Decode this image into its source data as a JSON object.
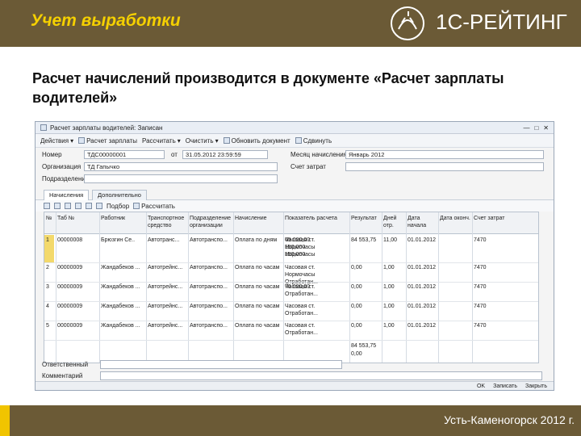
{
  "slide": {
    "title": "Учет выработки",
    "brand": "1С-РЕЙТИНГ",
    "lead": "Расчет начислений производится в документе «Расчет зарплаты водителей»",
    "footer": "Усть-Каменогорск  2012 г."
  },
  "window": {
    "title": "Расчет зарплаты водителей: Записан",
    "toolbar": [
      "Действия",
      "Расчет зарплаты",
      "Рассчитать",
      "Очистить",
      "Обновить документ",
      "Сдвинуть"
    ],
    "fields": {
      "number_label": "Номер",
      "number_value": "ТДС00000001",
      "date_label": "от",
      "date_value": "31.05.2012 23:59:59",
      "period_label": "Месяц начисления",
      "period_value": "Январь 2012",
      "org_label": "Организация",
      "org_value": "ТД Гапычко",
      "account_label": "Счет затрат",
      "account_value": "",
      "dept_label": "Подразделение",
      "dept_value": ""
    },
    "tabs": [
      "Начисления",
      "Дополнительно"
    ],
    "table_toolbar": [
      "Подбор",
      "Рассчитать"
    ],
    "columns": [
      "№",
      "Таб №",
      "Работник",
      "Транспортное средство",
      "Подразделение организации",
      "Начисление",
      "Показатель расчета",
      "Результат",
      "Дней отр.",
      "Дата начала",
      "Дата оконч.",
      "Счет затрат"
    ],
    "rows": [
      {
        "n": "1",
        "tab": "00000008",
        "worker": "Брюзгин Се..",
        "transport": "Автотранс...",
        "dept": "Автотранспо...",
        "accrual": "Оплата по дням",
        "indicators": [
          "Часовая ст.",
          "Нормочасы",
          "Нормочасы"
        ],
        "values": [
          "65 000,00",
          "150,000",
          "150,000"
        ],
        "result": "84 553,75",
        "days": "11,00",
        "start": "01.01.2012",
        "end": "",
        "account": "7470"
      },
      {
        "n": "2",
        "tab": "00000009",
        "worker": "Жандабеков ...",
        "transport": "Автотрейнс...",
        "dept": "Автотранспо...",
        "accrual": "Оплата по часам",
        "indicators": [
          "Часовая ст.",
          "Нормочасы",
          "Отработан..."
        ],
        "values": [
          "",
          "",
          ""
        ],
        "result": "0,00",
        "days": "1,00",
        "start": "01.01.2012",
        "end": "",
        "account": "7470"
      },
      {
        "n": "3",
        "tab": "00000009",
        "worker": "Жандабеков ...",
        "transport": "Автотрейнс...",
        "dept": "Автотранспо...",
        "accrual": "Оплата по часам",
        "indicators": [
          "Часовая ст.",
          "Отработан..."
        ],
        "values": [
          "70 000,00",
          ""
        ],
        "result": "0,00",
        "days": "1,00",
        "start": "01.01.2012",
        "end": "",
        "account": "7470"
      },
      {
        "n": "4",
        "tab": "00000009",
        "worker": "Жандабеков ...",
        "transport": "Автотрейнс...",
        "dept": "Автотранспо...",
        "accrual": "Оплата по часам",
        "indicators": [
          "Часовая ст.",
          "Отработан..."
        ],
        "values": [
          "",
          ""
        ],
        "result": "0,00",
        "days": "1,00",
        "start": "01.01.2012",
        "end": "",
        "account": "7470"
      },
      {
        "n": "5",
        "tab": "00000009",
        "worker": "Жандабеков ...",
        "transport": "Автотрейнс...",
        "dept": "Автотранспо...",
        "accrual": "Оплата по часам",
        "indicators": [
          "Часовая ст.",
          "Отработан..."
        ],
        "values": [
          "",
          ""
        ],
        "result": "0,00",
        "days": "1,00",
        "start": "01.01.2012",
        "end": "",
        "account": "7470"
      }
    ],
    "totals": [
      "84 553,75",
      "0,00"
    ],
    "bottom_fields": {
      "resp_label": "Ответственный",
      "comment_label": "Комментарий"
    },
    "status": [
      "OK",
      "Записать",
      "Закрыть"
    ]
  }
}
